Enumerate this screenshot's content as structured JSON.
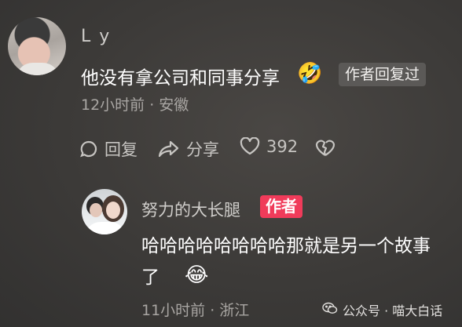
{
  "comment1": {
    "username": "L y",
    "text": "他没有拿公司和同事分享",
    "emoji": "🤣",
    "author_replied": "作者回复过",
    "meta": "12小时前 · 安徽",
    "actions": {
      "reply": "回复",
      "share": "分享",
      "likes": "392"
    }
  },
  "comment2": {
    "username": "努力的大长腿",
    "badge": "作者",
    "text": "哈哈哈哈哈哈哈哈那就是另一个故事了",
    "emoji": "😂",
    "meta": "11小时前 · 浙江"
  },
  "watermark": {
    "label": "公众号 · 喵大白话"
  },
  "colors": {
    "background": "#3c3a38",
    "badge": "#f03b5a",
    "muted": "#a9a6a3"
  }
}
